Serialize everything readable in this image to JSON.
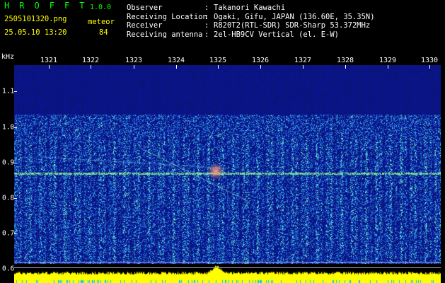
{
  "header": {
    "app_title": "H R O F F T",
    "app_version": "1.0.0",
    "file_name": "2505101320.png",
    "date_time": "25.05.10 13:20",
    "meteor_label": "meteor",
    "meteor_count": "84"
  },
  "info": {
    "rows": [
      {
        "label": "Observer",
        "colon": ":",
        "value": "Takanori Kawachi"
      },
      {
        "label": "Receiving Location",
        "colon": ":",
        "value": "Ogaki, Gifu, JAPAN (136.60E, 35.35N)"
      },
      {
        "label": "Receiver",
        "colon": ":",
        "value": "R820T2(RTL-SDR) SDR-Sharp 53.372MHz"
      },
      {
        "label": "Receiving antenna",
        "colon": ":",
        "value": "2el-HB9CV Vertical (el. E-W)"
      }
    ]
  },
  "axes": {
    "y_unit": "kHz",
    "x_ticks": [
      "1321",
      "1322",
      "1323",
      "1324",
      "1325",
      "1326",
      "1327",
      "1328",
      "1329",
      "1330"
    ],
    "y_ticks": [
      "1.1",
      "1.0",
      "0.9",
      "0.8",
      "0.7",
      "0.6"
    ]
  },
  "colors": {
    "background": "#000000",
    "spectrogram_base": "#0a1a8c",
    "carrier_line": "#40ff80",
    "level_bar": "#ffff00",
    "level_bar_base": "#00c8ff",
    "title_green": "#00ff00",
    "text_yellow": "#ffff00"
  }
}
